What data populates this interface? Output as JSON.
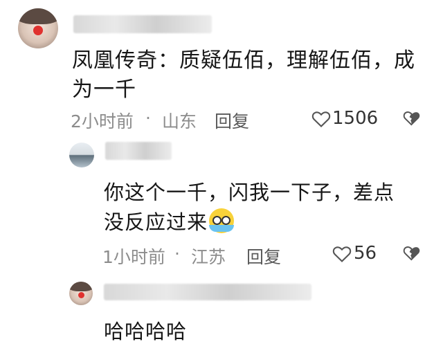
{
  "comments": [
    {
      "text_line1": "凤凰传奇：质疑伍佰，理解伍佰，成",
      "text_line2": "为一千",
      "time": "2小时前",
      "dot": "·",
      "location": "山东",
      "reply_label": "回复",
      "likes": "1506"
    },
    {
      "text_line1": "你这个一千，闪我一下子，差点",
      "text_line2": "没反应过来",
      "emoji": "crying-laughing-emoji",
      "time": "1小时前",
      "dot": "·",
      "location": "江苏",
      "reply_label": "回复",
      "likes": "56"
    },
    {
      "text_line1": "哈哈哈哈"
    }
  ],
  "icons": {
    "like": "heart-outline-icon",
    "dislike": "broken-heart-icon"
  },
  "colors": {
    "text": "#161616",
    "meta": "#8c8c8c",
    "avatar_nose": "#e0322f"
  }
}
